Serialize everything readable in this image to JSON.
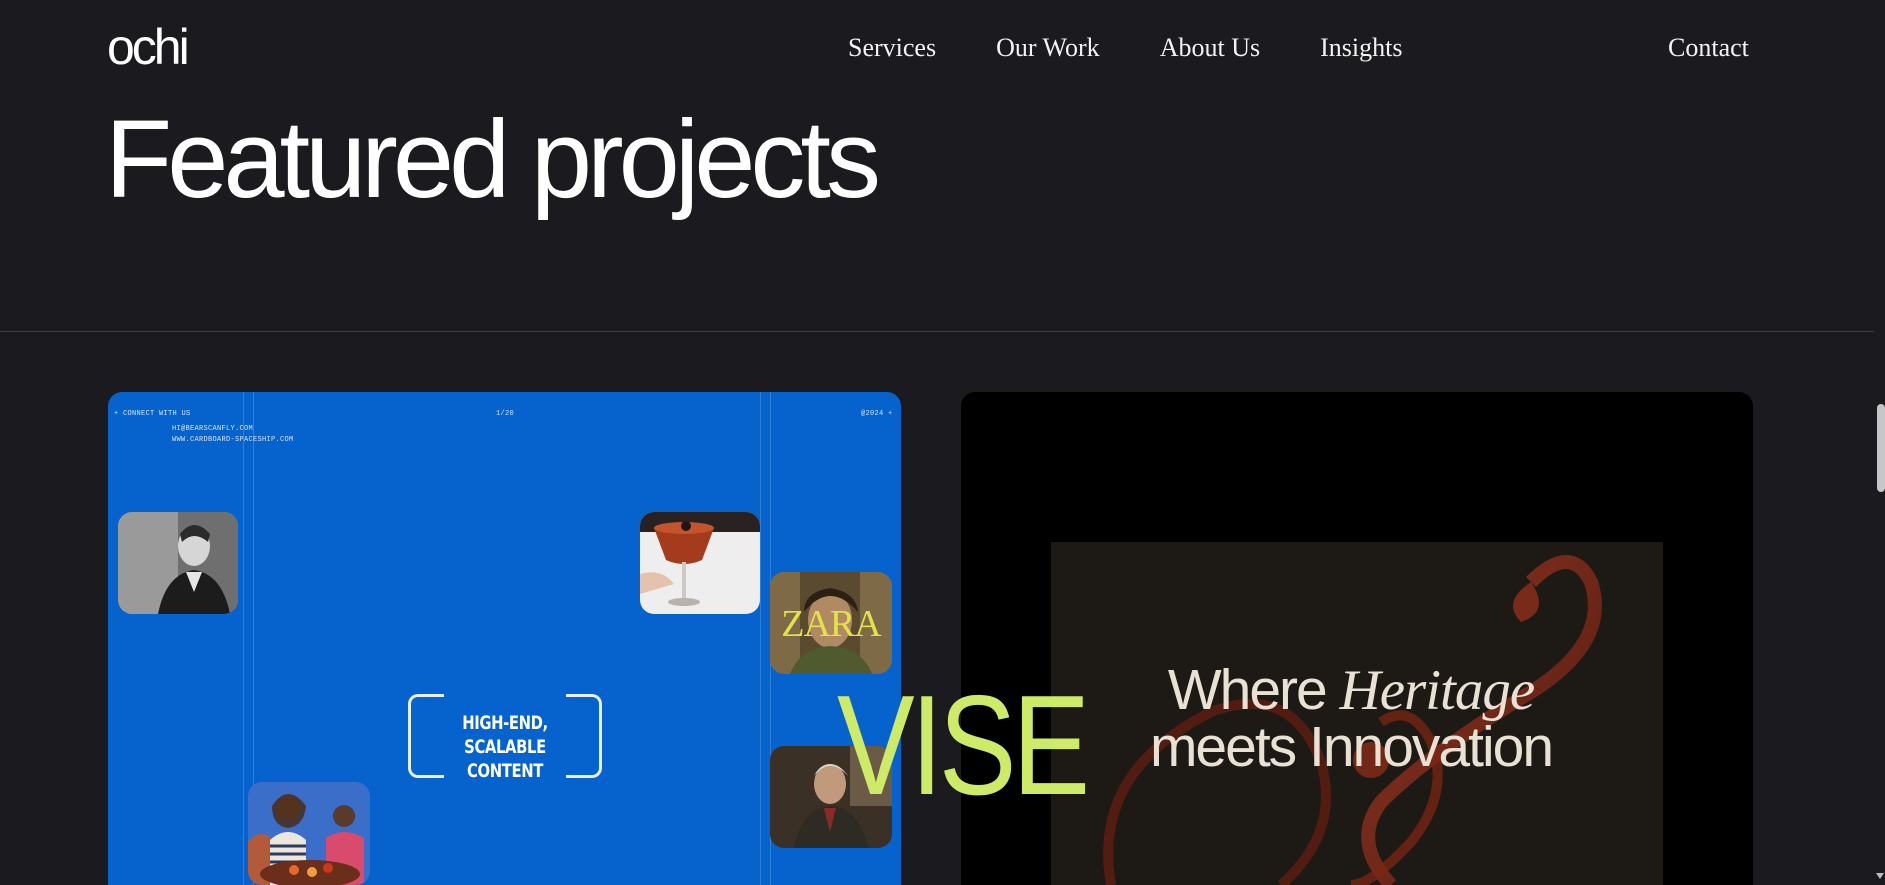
{
  "nav": {
    "logo": "ochi",
    "links": [
      "Services",
      "Our Work",
      "About Us",
      "Insights"
    ],
    "contact": "Contact"
  },
  "section": {
    "title": "Featured projects"
  },
  "projects": [
    {
      "name": "Cardboard Spaceship",
      "top_left": "+ CONNECT WITH US",
      "email": "HI@BEARSCANFLY.COM",
      "website": "WWW.CARDBOARD-SPACESHIP.COM",
      "counter": "1/20",
      "year": "@2024 +",
      "tagline_line1": "HIGH-END,",
      "tagline_line2": "SCALABLE CONTENT",
      "thumbnails": [
        "man-in-suit-photo",
        "cocktail-photo",
        "zara-ad-photo",
        "group-dining-photo",
        "older-man-photo"
      ],
      "zara_text": "ZARA"
    },
    {
      "name": "Vise",
      "hero_line1_a": "Where ",
      "hero_line1_b": "Heritage",
      "hero_line2": "meets Innovation"
    }
  ],
  "hover_label": "VISE",
  "colors": {
    "background": "#1b1a1e",
    "card_blue": "#0662cc",
    "accent_lime": "#cdea68",
    "card_black": "#000000"
  }
}
